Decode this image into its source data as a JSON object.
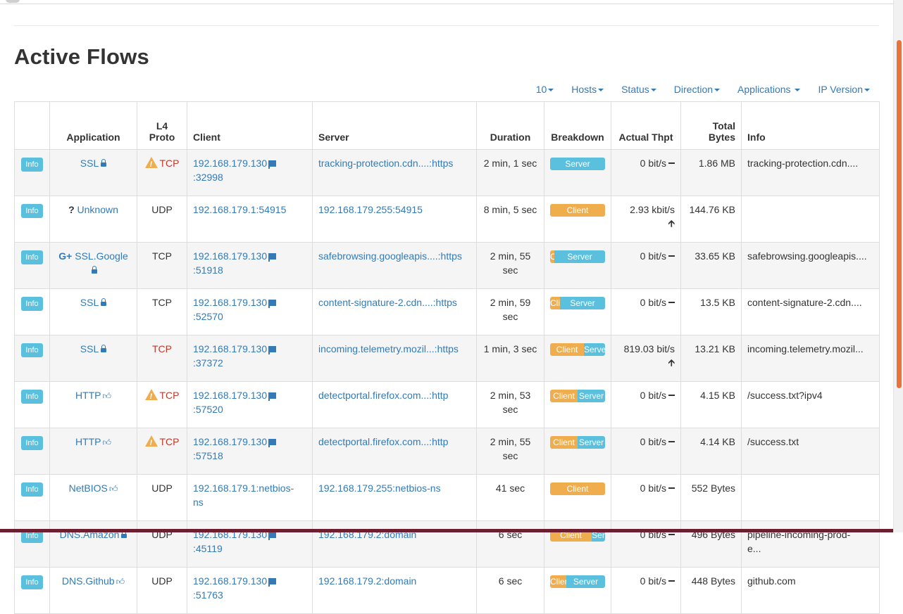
{
  "page_title": "Active Flows",
  "filters": [
    {
      "label": "10"
    },
    {
      "label": "Hosts"
    },
    {
      "label": "Status"
    },
    {
      "label": "Direction"
    },
    {
      "label": "Applications"
    },
    {
      "label": "IP Version"
    }
  ],
  "columns": {
    "application": "Application",
    "l4_line1": "L4",
    "l4_line2": "Proto",
    "client": "Client",
    "server": "Server",
    "duration": "Duration",
    "breakdown": "Breakdown",
    "thpt": "Actual Thpt",
    "bytes_line1": "Total",
    "bytes_line2": "Bytes",
    "info": "Info"
  },
  "info_button_label": "Info",
  "rows": [
    {
      "app": "SSL",
      "app_icon": "lock",
      "proto": "TCP",
      "warn": true,
      "client": "192.168.179.130",
      "client_port": ":32998",
      "client_flag": true,
      "server": "tracking-protection.cdn....:https",
      "duration": "2 min, 1 sec",
      "client_pct": 0,
      "client_label": "",
      "server_label": "Server",
      "thpt": "0 bit/s",
      "trend": "flat",
      "bytes": "1.86 MB",
      "info": "tracking-protection.cdn...."
    },
    {
      "app": "Unknown",
      "app_icon": "question",
      "proto": "UDP",
      "warn": false,
      "client": "192.168.179.1:54915",
      "client_port": "",
      "client_flag": false,
      "server": "192.168.179.255:54915",
      "duration": "8 min, 5 sec",
      "client_pct": 100,
      "client_label": "Client",
      "server_label": "",
      "thpt": "2.93 kbit/s",
      "trend": "up",
      "bytes": "144.76 KB",
      "info": ""
    },
    {
      "app": "SSL.Google",
      "app_icon": "google-lock",
      "proto": "TCP",
      "warn": false,
      "client": "192.168.179.130",
      "client_port": ":51918",
      "client_flag": true,
      "server": "safebrowsing.googleapis....:https",
      "duration": "2 min, 55 sec",
      "client_pct": 8,
      "client_label": "C",
      "server_label": "Server",
      "thpt": "0 bit/s",
      "trend": "flat",
      "bytes": "33.65 KB",
      "info": "safebrowsing.googleapis...."
    },
    {
      "app": "SSL",
      "app_icon": "lock",
      "proto": "TCP",
      "warn": false,
      "client": "192.168.179.130",
      "client_port": ":52570",
      "client_flag": true,
      "server": "content-signature-2.cdn....:https",
      "duration": "2 min, 59 sec",
      "client_pct": 18,
      "client_label": "Cli",
      "server_label": "Server",
      "thpt": "0 bit/s",
      "trend": "flat",
      "bytes": "13.5 KB",
      "info": "content-signature-2.cdn...."
    },
    {
      "app": "SSL",
      "app_icon": "lock",
      "proto": "TCP",
      "warn": false,
      "proto_red": true,
      "client": "192.168.179.130",
      "client_port": ":37372",
      "client_flag": true,
      "server": "incoming.telemetry.mozil...:https",
      "duration": "1 min, 3 sec",
      "client_pct": 62,
      "client_label": "Client",
      "server_label": "Serve",
      "thpt": "819.03 bit/s",
      "trend": "up",
      "bytes": "13.21 KB",
      "info": "incoming.telemetry.mozil..."
    },
    {
      "app": "HTTP",
      "app_icon": "thumb",
      "proto": "TCP",
      "warn": true,
      "client": "192.168.179.130",
      "client_port": ":57520",
      "client_flag": true,
      "server": "detectportal.firefox.com...:http",
      "duration": "2 min, 53 sec",
      "client_pct": 50,
      "client_label": "Client",
      "server_label": "Server",
      "thpt": "0 bit/s",
      "trend": "flat",
      "bytes": "4.15 KB",
      "info": "/success.txt?ipv4"
    },
    {
      "app": "HTTP",
      "app_icon": "thumb",
      "proto": "TCP",
      "warn": true,
      "client": "192.168.179.130",
      "client_port": ":57518",
      "client_flag": true,
      "server": "detectportal.firefox.com...:http",
      "duration": "2 min, 55 sec",
      "client_pct": 50,
      "client_label": "Client",
      "server_label": "Server",
      "thpt": "0 bit/s",
      "trend": "flat",
      "bytes": "4.14 KB",
      "info": "/success.txt"
    },
    {
      "app": "NetBIOS",
      "app_icon": "thumb",
      "proto": "UDP",
      "warn": false,
      "client": "192.168.179.1:netbios-",
      "client_port": "ns",
      "client_flag": false,
      "server": "192.168.179.255:netbios-ns",
      "duration": "41 sec",
      "client_pct": 100,
      "client_label": "Client",
      "server_label": "",
      "thpt": "0 bit/s",
      "trend": "flat",
      "bytes": "552 Bytes",
      "info": "",
      "client_port_is_link": true
    },
    {
      "app": "DNS.Amazon",
      "app_icon": "lock",
      "proto": "UDP",
      "warn": false,
      "client": "192.168.179.130",
      "client_port": ":45119",
      "client_flag": true,
      "server": "192.168.179.2:domain",
      "duration": "6 sec",
      "client_pct": 75,
      "client_label": "Client",
      "server_label": "Ser",
      "thpt": "0 bit/s",
      "trend": "flat",
      "bytes": "496 Bytes",
      "info": "pipeline-incoming-prod-",
      "info2": "e..."
    },
    {
      "app": "DNS.Github",
      "app_icon": "thumb",
      "proto": "UDP",
      "warn": false,
      "client": "192.168.179.130",
      "client_port": ":51763",
      "client_flag": true,
      "server": "192.168.179.2:domain",
      "duration": "6 sec",
      "client_pct": 30,
      "client_label": "Clier",
      "server_label": "Server",
      "thpt": "0 bit/s",
      "trend": "flat",
      "bytes": "448 Bytes",
      "info": "github.com"
    }
  ]
}
